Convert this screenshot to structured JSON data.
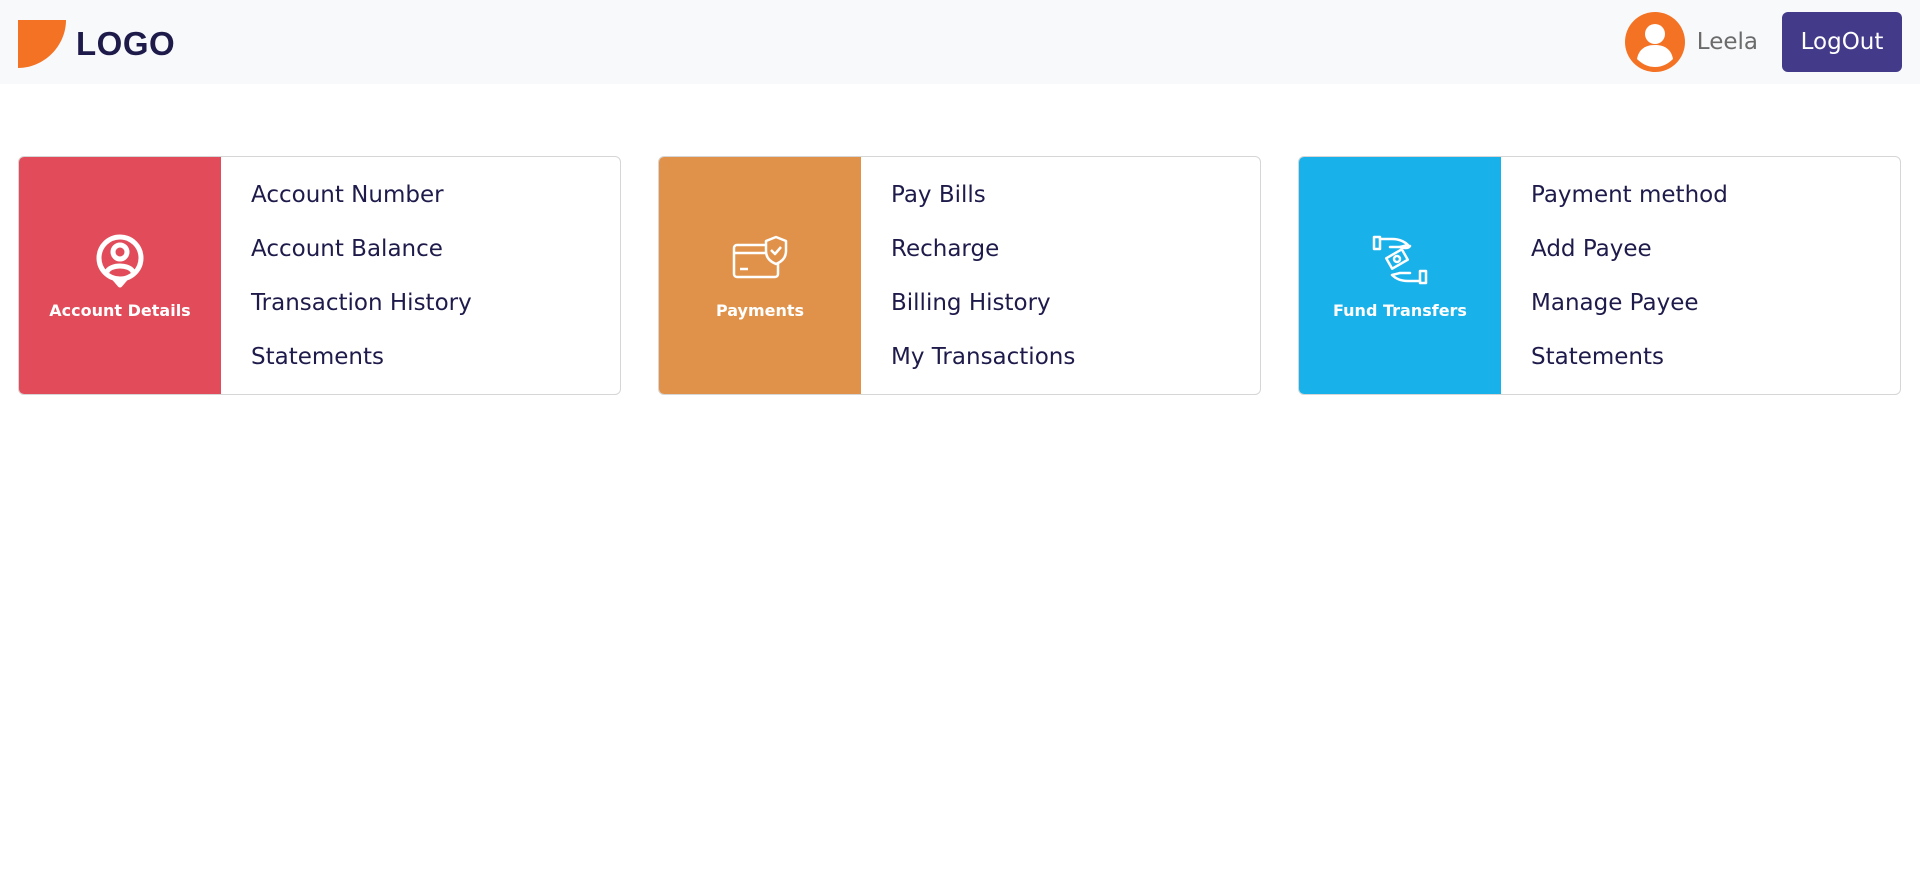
{
  "header": {
    "logo_text": "LOGO",
    "brand_color": "#f47224",
    "username": "Leela",
    "logout_label": "LogOut",
    "logout_color": "#433a8a"
  },
  "cards": [
    {
      "title": "Account Details",
      "color": "#e24b5a",
      "icon": "user-pin-icon",
      "links": [
        "Account Number",
        "Account Balance",
        "Transaction History",
        "Statements"
      ]
    },
    {
      "title": "Payments",
      "color": "#e1924a",
      "icon": "secure-card-icon",
      "links": [
        "Pay Bills",
        "Recharge",
        "Billing History",
        "My Transactions"
      ]
    },
    {
      "title": "Fund Transfers",
      "color": "#18b1ea",
      "icon": "hand-transfer-icon",
      "links": [
        "Payment method",
        "Add Payee",
        "Manage Payee",
        "Statements"
      ]
    }
  ]
}
